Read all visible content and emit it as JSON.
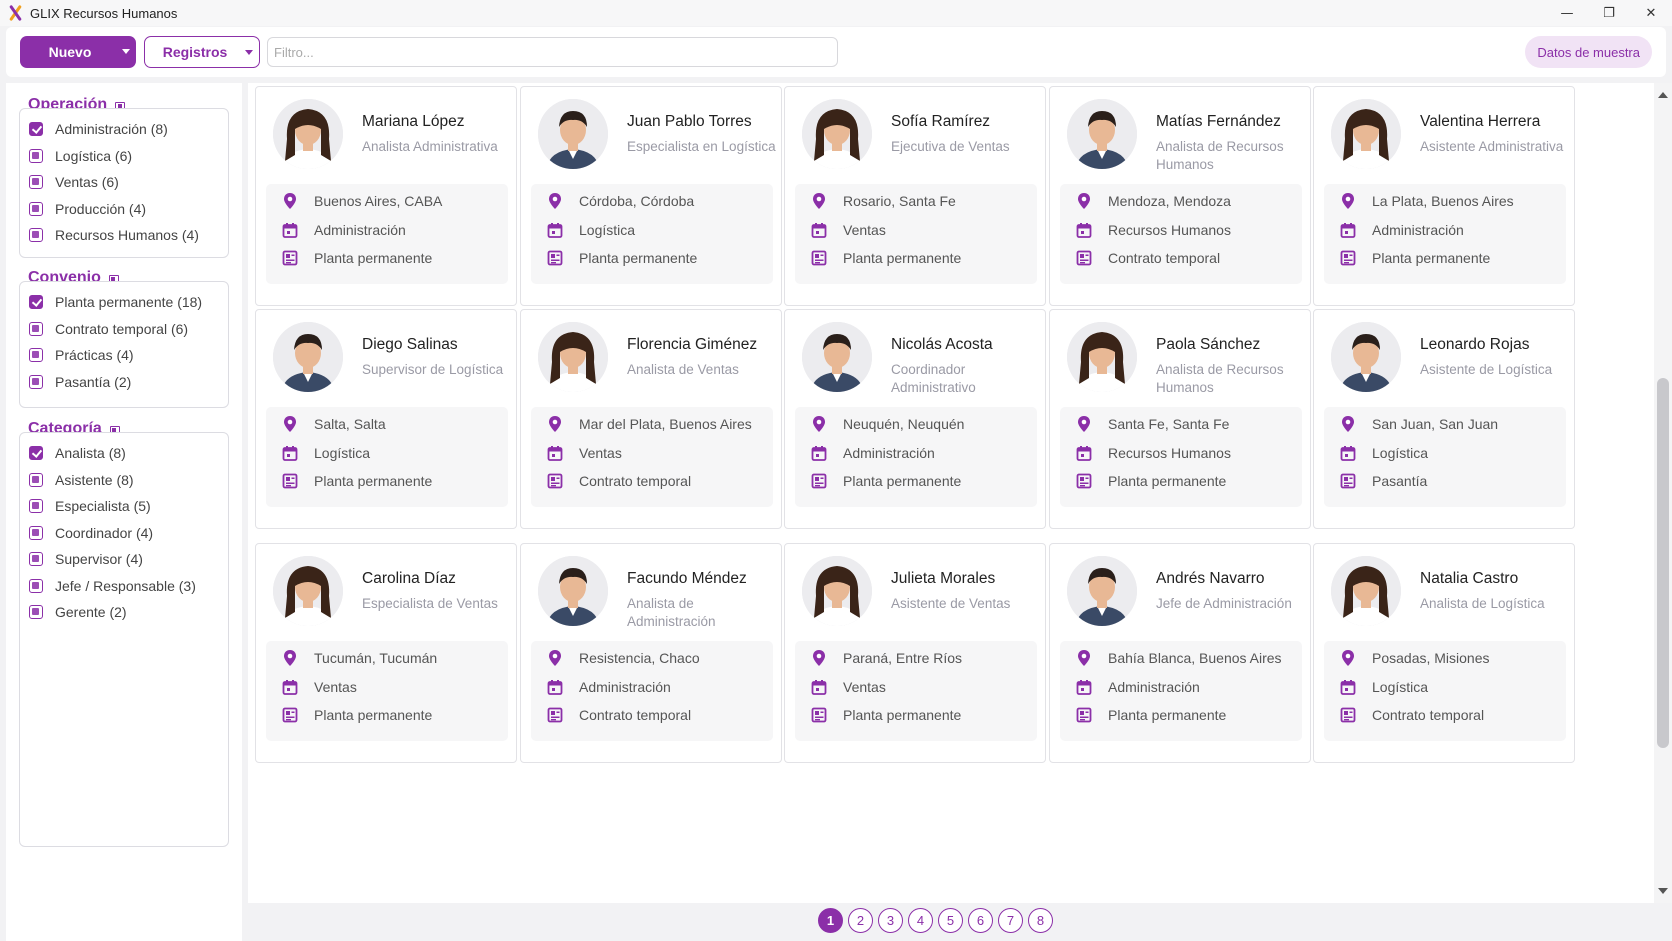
{
  "window": {
    "title": "GLIX Recursos Humanos",
    "minimize": "—",
    "restore": "❐",
    "close": "✕"
  },
  "toolbar": {
    "new_label": "Nuevo",
    "records_label": "Registros",
    "filter_placeholder": "Filtro...",
    "sample_label": "Datos de muestra"
  },
  "sidebar": {
    "groups": [
      {
        "title": "Operación",
        "items": [
          {
            "label": "Administración (8)",
            "checked": true
          },
          {
            "label": "Logística (6)",
            "checked": false
          },
          {
            "label": "Ventas (6)",
            "checked": false
          },
          {
            "label": "Producción (4)",
            "checked": false
          },
          {
            "label": "Recursos Humanos (4)",
            "checked": false
          }
        ]
      },
      {
        "title": "Convenio",
        "items": [
          {
            "label": "Planta permanente (18)",
            "checked": true
          },
          {
            "label": "Contrato temporal (6)",
            "checked": false
          },
          {
            "label": "Prácticas (4)",
            "checked": false
          },
          {
            "label": "Pasantía (2)",
            "checked": false
          }
        ]
      },
      {
        "title": "Categoría",
        "items": [
          {
            "label": "Analista (8)",
            "checked": true
          },
          {
            "label": "Asistente (8)",
            "checked": false
          },
          {
            "label": "Especialista (5)",
            "checked": false
          },
          {
            "label": "Coordinador (4)",
            "checked": false
          },
          {
            "label": "Supervisor (4)",
            "checked": false
          },
          {
            "label": "Jefe / Responsable (3)",
            "checked": false
          },
          {
            "label": "Gerente (2)",
            "checked": false
          }
        ]
      }
    ]
  },
  "employees": [
    {
      "name": "Mariana López",
      "role": "Analista Administrativa",
      "location": "Buenos Aires, CABA",
      "area": "Administración",
      "contract": "Planta permanente",
      "gender": "f"
    },
    {
      "name": "Juan Pablo Torres",
      "role": "Especialista en Logística",
      "location": "Córdoba, Córdoba",
      "area": "Logística",
      "contract": "Planta permanente",
      "gender": "m"
    },
    {
      "name": "Sofía Ramírez",
      "role": "Ejecutiva de Ventas",
      "location": "Rosario, Santa Fe",
      "area": "Ventas",
      "contract": "Planta permanente",
      "gender": "f"
    },
    {
      "name": "Matías Fernández",
      "role": "Analista de Recursos Humanos",
      "location": "Mendoza, Mendoza",
      "area": "Recursos Humanos",
      "contract": "Contrato temporal",
      "gender": "m"
    },
    {
      "name": "Valentina Herrera",
      "role": "Asistente Administrativa",
      "location": "La Plata, Buenos Aires",
      "area": "Administración",
      "contract": "Planta permanente",
      "gender": "f"
    },
    {
      "name": "Diego Salinas",
      "role": "Supervisor de Logística",
      "location": "Salta, Salta",
      "area": "Logística",
      "contract": "Planta permanente",
      "gender": "m"
    },
    {
      "name": "Florencia Giménez",
      "role": "Analista de Ventas",
      "location": "Mar del Plata, Buenos Aires",
      "area": "Ventas",
      "contract": "Contrato temporal",
      "gender": "f"
    },
    {
      "name": "Nicolás Acosta",
      "role": "Coordinador Administrativo",
      "location": "Neuquén, Neuquén",
      "area": "Administración",
      "contract": "Planta permanente",
      "gender": "m"
    },
    {
      "name": "Paola Sánchez",
      "role": "Analista de Recursos Humanos",
      "location": "Santa Fe, Santa Fe",
      "area": "Recursos Humanos",
      "contract": "Planta permanente",
      "gender": "f"
    },
    {
      "name": "Leonardo Rojas",
      "role": "Asistente de Logística",
      "location": "San Juan, San Juan",
      "area": "Logística",
      "contract": "Pasantía",
      "gender": "m"
    },
    {
      "name": "Carolina Díaz",
      "role": "Especialista de Ventas",
      "location": "Tucumán, Tucumán",
      "area": "Ventas",
      "contract": "Planta permanente",
      "gender": "f"
    },
    {
      "name": "Facundo Méndez",
      "role": "Analista de Administración",
      "location": "Resistencia, Chaco",
      "area": "Administración",
      "contract": "Contrato temporal",
      "gender": "m"
    },
    {
      "name": "Julieta Morales",
      "role": "Asistente de Ventas",
      "location": "Paraná, Entre Ríos",
      "area": "Ventas",
      "contract": "Planta permanente",
      "gender": "f"
    },
    {
      "name": "Andrés Navarro",
      "role": "Jefe de Administración",
      "location": "Bahía Blanca, Buenos Aires",
      "area": "Administración",
      "contract": "Planta permanente",
      "gender": "m"
    },
    {
      "name": "Natalia Castro",
      "role": "Analista de Logística",
      "location": "Posadas, Misiones",
      "area": "Logística",
      "contract": "Contrato temporal",
      "gender": "f"
    }
  ],
  "pagination": {
    "pages": [
      "1",
      "2",
      "3",
      "4",
      "5",
      "6",
      "7",
      "8"
    ],
    "current": "1"
  },
  "colors": {
    "accent": "#8b2fa8",
    "muted_text": "#9a9aa5"
  },
  "icons": {
    "location": "map-pin-icon",
    "area": "calendar-icon",
    "contract": "id-card-icon"
  }
}
